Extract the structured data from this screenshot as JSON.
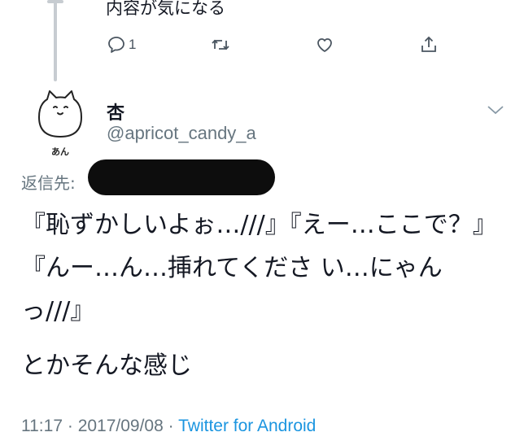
{
  "previous_tweet": {
    "text_tail": "内容が気になる",
    "reply_count": "1"
  },
  "tweet": {
    "author_name": "杏",
    "author_handle": "@apricot_candy_a",
    "reply_to_label": "返信先:",
    "body": "『恥ずかしいよぉ…///』『えー…ここで？』『んー…ん…挿れてくださ い…にゃんっ///』",
    "body_line2": "とかそんな感じ",
    "time": "11:17",
    "date": "2017/09/08",
    "separator": "·",
    "client": "Twitter for Android"
  },
  "avatar": {
    "caption": "あん"
  },
  "colors": {
    "text": "#141823",
    "secondary": "#66757f",
    "link": "#1b95e0",
    "thread_line": "#c7ccd1",
    "redaction": "#0d0d0d"
  },
  "icons": [
    "reply-icon",
    "retweet-icon",
    "like-icon",
    "share-icon",
    "chevron-down-icon"
  ]
}
